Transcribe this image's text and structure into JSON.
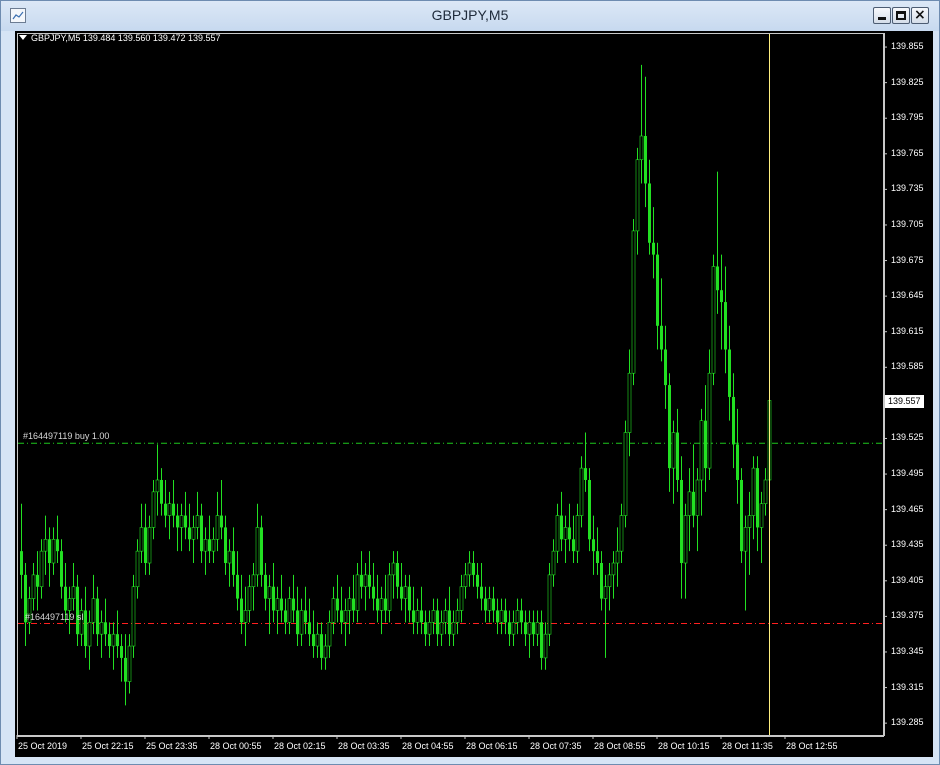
{
  "window": {
    "title": "GBPJPY,M5"
  },
  "colors": {
    "background": "#000000",
    "candle": "#22e022",
    "buy_line": "#1ec81e",
    "sl_line": "#ff2020",
    "cursor_line": "#fff080",
    "axis_text": "#ffffff"
  },
  "icons": [
    "chart-window-icon",
    "minimize-icon",
    "maximize-icon",
    "close-icon",
    "dropdown-triangle-icon"
  ],
  "chart_data": {
    "type": "candlestick",
    "symbol_header": "GBPJPY,M5  139.484 139.560 139.472 139.557",
    "symbol": "GBPJPY",
    "timeframe": "M5",
    "ohlc_header": {
      "open": 139.484,
      "high": 139.56,
      "low": 139.472,
      "close": 139.557
    },
    "current_price": "139.557",
    "ylim": [
      139.28,
      139.87
    ],
    "y_ticks": [
      "139.855",
      "139.825",
      "139.795",
      "139.765",
      "139.735",
      "139.705",
      "139.675",
      "139.645",
      "139.615",
      "139.585",
      "139.555",
      "139.525",
      "139.495",
      "139.465",
      "139.435",
      "139.405",
      "139.375",
      "139.345",
      "139.315",
      "139.285"
    ],
    "x_ticks": [
      "25 Oct 2019",
      "25 Oct 22:15",
      "25 Oct 23:35",
      "28 Oct 00:55",
      "28 Oct 02:15",
      "28 Oct 03:35",
      "28 Oct 04:55",
      "28 Oct 06:15",
      "28 Oct 07:35",
      "28 Oct 08:55",
      "28 Oct 10:15",
      "28 Oct 11:35",
      "28 Oct 12:55"
    ],
    "order_lines": [
      {
        "label": "#164497119 buy 1.00",
        "price": 139.521,
        "kind": "buy"
      },
      {
        "label": "#164497119 sl",
        "price": 139.369,
        "kind": "sl"
      }
    ],
    "cursor_x_bar": 187,
    "bar_spacing_px": 4,
    "bars": [
      [
        139.43,
        139.47,
        139.39,
        139.41
      ],
      [
        139.41,
        139.42,
        139.35,
        139.37
      ],
      [
        139.37,
        139.4,
        139.36,
        139.39
      ],
      [
        139.39,
        139.42,
        139.38,
        139.41
      ],
      [
        139.41,
        139.43,
        139.38,
        139.4
      ],
      [
        139.4,
        139.44,
        139.39,
        139.43
      ],
      [
        139.43,
        139.46,
        139.41,
        139.44
      ],
      [
        139.44,
        139.45,
        139.4,
        139.42
      ],
      [
        139.42,
        139.45,
        139.41,
        139.44
      ],
      [
        139.44,
        139.46,
        139.42,
        139.43
      ],
      [
        139.43,
        139.44,
        139.39,
        139.4
      ],
      [
        139.4,
        139.42,
        139.37,
        139.38
      ],
      [
        139.38,
        139.4,
        139.36,
        139.39
      ],
      [
        139.39,
        139.42,
        139.38,
        139.4
      ],
      [
        139.4,
        139.41,
        139.35,
        139.36
      ],
      [
        139.36,
        139.39,
        139.35,
        139.38
      ],
      [
        139.38,
        139.4,
        139.34,
        139.35
      ],
      [
        139.35,
        139.38,
        139.33,
        139.37
      ],
      [
        139.37,
        139.41,
        139.36,
        139.39
      ],
      [
        139.39,
        139.4,
        139.35,
        139.36
      ],
      [
        139.36,
        139.38,
        139.34,
        139.37
      ],
      [
        139.37,
        139.39,
        139.35,
        139.36
      ],
      [
        139.36,
        139.37,
        139.34,
        139.35
      ],
      [
        139.35,
        139.37,
        139.33,
        139.36
      ],
      [
        139.36,
        139.38,
        139.34,
        139.35
      ],
      [
        139.35,
        139.36,
        139.32,
        139.34
      ],
      [
        139.34,
        139.36,
        139.3,
        139.32
      ],
      [
        139.32,
        139.36,
        139.31,
        139.35
      ],
      [
        139.35,
        139.41,
        139.34,
        139.4
      ],
      [
        139.4,
        139.44,
        139.39,
        139.43
      ],
      [
        139.43,
        139.47,
        139.42,
        139.45
      ],
      [
        139.45,
        139.47,
        139.41,
        139.42
      ],
      [
        139.42,
        139.46,
        139.41,
        139.45
      ],
      [
        139.45,
        139.49,
        139.44,
        139.48
      ],
      [
        139.48,
        139.52,
        139.46,
        139.49
      ],
      [
        139.49,
        139.5,
        139.46,
        139.47
      ],
      [
        139.47,
        139.49,
        139.45,
        139.46
      ],
      [
        139.46,
        139.48,
        139.44,
        139.47
      ],
      [
        139.47,
        139.49,
        139.45,
        139.46
      ],
      [
        139.46,
        139.47,
        139.43,
        139.45
      ],
      [
        139.45,
        139.47,
        139.43,
        139.46
      ],
      [
        139.46,
        139.48,
        139.44,
        139.45
      ],
      [
        139.45,
        139.47,
        139.43,
        139.44
      ],
      [
        139.44,
        139.46,
        139.42,
        139.45
      ],
      [
        139.45,
        139.48,
        139.44,
        139.46
      ],
      [
        139.46,
        139.47,
        139.42,
        139.43
      ],
      [
        139.43,
        139.45,
        139.41,
        139.44
      ],
      [
        139.44,
        139.46,
        139.42,
        139.43
      ],
      [
        139.43,
        139.45,
        139.42,
        139.44
      ],
      [
        139.44,
        139.48,
        139.43,
        139.46
      ],
      [
        139.46,
        139.49,
        139.44,
        139.45
      ],
      [
        139.45,
        139.46,
        139.41,
        139.42
      ],
      [
        139.42,
        139.44,
        139.4,
        139.43
      ],
      [
        139.43,
        139.45,
        139.4,
        139.41
      ],
      [
        139.41,
        139.43,
        139.38,
        139.39
      ],
      [
        139.39,
        139.41,
        139.36,
        139.37
      ],
      [
        139.37,
        139.4,
        139.35,
        139.38
      ],
      [
        139.38,
        139.41,
        139.37,
        139.4
      ],
      [
        139.4,
        139.42,
        139.38,
        139.41
      ],
      [
        139.41,
        139.47,
        139.4,
        139.45
      ],
      [
        139.45,
        139.46,
        139.4,
        139.41
      ],
      [
        139.41,
        139.42,
        139.38,
        139.39
      ],
      [
        139.39,
        139.41,
        139.36,
        139.4
      ],
      [
        139.4,
        139.42,
        139.37,
        139.38
      ],
      [
        139.38,
        139.4,
        139.36,
        139.39
      ],
      [
        139.39,
        139.41,
        139.37,
        139.38
      ],
      [
        139.38,
        139.39,
        139.36,
        139.37
      ],
      [
        139.37,
        139.4,
        139.36,
        139.39
      ],
      [
        139.39,
        139.41,
        139.37,
        139.38
      ],
      [
        139.38,
        139.4,
        139.35,
        139.36
      ],
      [
        139.36,
        139.39,
        139.35,
        139.38
      ],
      [
        139.38,
        139.4,
        139.36,
        139.37
      ],
      [
        139.37,
        139.39,
        139.35,
        139.36
      ],
      [
        139.36,
        139.38,
        139.34,
        139.35
      ],
      [
        139.35,
        139.37,
        139.34,
        139.36
      ],
      [
        139.36,
        139.37,
        139.33,
        139.34
      ],
      [
        139.34,
        139.36,
        139.33,
        139.35
      ],
      [
        139.35,
        139.38,
        139.34,
        139.37
      ],
      [
        139.37,
        139.4,
        139.36,
        139.39
      ],
      [
        139.39,
        139.41,
        139.37,
        139.38
      ],
      [
        139.38,
        139.4,
        139.36,
        139.37
      ],
      [
        139.37,
        139.39,
        139.35,
        139.38
      ],
      [
        139.38,
        139.4,
        139.36,
        139.39
      ],
      [
        139.39,
        139.41,
        139.37,
        139.38
      ],
      [
        139.38,
        139.42,
        139.37,
        139.41
      ],
      [
        139.41,
        139.43,
        139.39,
        139.4
      ],
      [
        139.4,
        139.42,
        139.38,
        139.41
      ],
      [
        139.41,
        139.43,
        139.39,
        139.4
      ],
      [
        139.4,
        139.42,
        139.38,
        139.39
      ],
      [
        139.39,
        139.41,
        139.37,
        139.38
      ],
      [
        139.38,
        139.4,
        139.36,
        139.39
      ],
      [
        139.39,
        139.41,
        139.37,
        139.38
      ],
      [
        139.38,
        139.42,
        139.37,
        139.41
      ],
      [
        139.41,
        139.43,
        139.39,
        139.42
      ],
      [
        139.42,
        139.43,
        139.39,
        139.4
      ],
      [
        139.4,
        139.42,
        139.38,
        139.39
      ],
      [
        139.39,
        139.41,
        139.37,
        139.4
      ],
      [
        139.4,
        139.41,
        139.37,
        139.38
      ],
      [
        139.38,
        139.4,
        139.36,
        139.37
      ],
      [
        139.37,
        139.39,
        139.36,
        139.38
      ],
      [
        139.38,
        139.4,
        139.36,
        139.37
      ],
      [
        139.37,
        139.38,
        139.35,
        139.36
      ],
      [
        139.36,
        139.38,
        139.35,
        139.37
      ],
      [
        139.37,
        139.39,
        139.36,
        139.38
      ],
      [
        139.38,
        139.39,
        139.35,
        139.36
      ],
      [
        139.36,
        139.38,
        139.35,
        139.37
      ],
      [
        139.37,
        139.39,
        139.36,
        139.38
      ],
      [
        139.38,
        139.4,
        139.35,
        139.36
      ],
      [
        139.36,
        139.38,
        139.35,
        139.37
      ],
      [
        139.37,
        139.39,
        139.36,
        139.38
      ],
      [
        139.38,
        139.41,
        139.37,
        139.4
      ],
      [
        139.4,
        139.42,
        139.39,
        139.41
      ],
      [
        139.41,
        139.43,
        139.4,
        139.42
      ],
      [
        139.42,
        139.43,
        139.4,
        139.41
      ],
      [
        139.41,
        139.42,
        139.39,
        139.4
      ],
      [
        139.4,
        139.42,
        139.38,
        139.39
      ],
      [
        139.39,
        139.4,
        139.37,
        139.38
      ],
      [
        139.38,
        139.4,
        139.37,
        139.39
      ],
      [
        139.39,
        139.4,
        139.37,
        139.38
      ],
      [
        139.38,
        139.39,
        139.36,
        139.37
      ],
      [
        139.37,
        139.39,
        139.36,
        139.38
      ],
      [
        139.38,
        139.39,
        139.36,
        139.37
      ],
      [
        139.37,
        139.38,
        139.35,
        139.36
      ],
      [
        139.36,
        139.38,
        139.35,
        139.37
      ],
      [
        139.37,
        139.39,
        139.36,
        139.38
      ],
      [
        139.38,
        139.39,
        139.36,
        139.37
      ],
      [
        139.37,
        139.38,
        139.35,
        139.36
      ],
      [
        139.36,
        139.38,
        139.34,
        139.37
      ],
      [
        139.37,
        139.38,
        139.35,
        139.36
      ],
      [
        139.36,
        139.38,
        139.35,
        139.37
      ],
      [
        139.37,
        139.38,
        139.33,
        139.34
      ],
      [
        139.34,
        139.37,
        139.33,
        139.36
      ],
      [
        139.36,
        139.42,
        139.35,
        139.41
      ],
      [
        139.41,
        139.44,
        139.4,
        139.43
      ],
      [
        139.43,
        139.47,
        139.42,
        139.46
      ],
      [
        139.46,
        139.48,
        139.43,
        139.44
      ],
      [
        139.44,
        139.46,
        139.42,
        139.45
      ],
      [
        139.45,
        139.47,
        139.43,
        139.44
      ],
      [
        139.44,
        139.46,
        139.42,
        139.43
      ],
      [
        139.43,
        139.47,
        139.42,
        139.46
      ],
      [
        139.46,
        139.51,
        139.45,
        139.5
      ],
      [
        139.5,
        139.53,
        139.48,
        139.49
      ],
      [
        139.49,
        139.5,
        139.43,
        139.44
      ],
      [
        139.44,
        139.46,
        139.41,
        139.43
      ],
      [
        139.43,
        139.45,
        139.41,
        139.42
      ],
      [
        139.42,
        139.43,
        139.38,
        139.39
      ],
      [
        139.39,
        139.41,
        139.34,
        139.4
      ],
      [
        139.4,
        139.42,
        139.38,
        139.41
      ],
      [
        139.41,
        139.43,
        139.39,
        139.42
      ],
      [
        139.42,
        139.45,
        139.4,
        139.43
      ],
      [
        139.43,
        139.47,
        139.42,
        139.46
      ],
      [
        139.46,
        139.54,
        139.45,
        139.53
      ],
      [
        139.53,
        139.6,
        139.51,
        139.58
      ],
      [
        139.58,
        139.71,
        139.57,
        139.7
      ],
      [
        139.7,
        139.77,
        139.68,
        139.76
      ],
      [
        139.76,
        139.84,
        139.74,
        139.78
      ],
      [
        139.78,
        139.83,
        139.72,
        139.74
      ],
      [
        139.74,
        139.76,
        139.68,
        139.69
      ],
      [
        139.69,
        139.72,
        139.66,
        139.68
      ],
      [
        139.68,
        139.69,
        139.6,
        139.62
      ],
      [
        139.62,
        139.66,
        139.59,
        139.6
      ],
      [
        139.6,
        139.62,
        139.55,
        139.57
      ],
      [
        139.57,
        139.58,
        139.48,
        139.5
      ],
      [
        139.5,
        139.54,
        139.47,
        139.53
      ],
      [
        139.53,
        139.55,
        139.48,
        139.49
      ],
      [
        139.49,
        139.51,
        139.39,
        139.42
      ],
      [
        139.42,
        139.47,
        139.39,
        139.46
      ],
      [
        139.46,
        139.5,
        139.43,
        139.48
      ],
      [
        139.48,
        139.52,
        139.45,
        139.46
      ],
      [
        139.46,
        139.5,
        139.43,
        139.49
      ],
      [
        139.49,
        139.55,
        139.46,
        139.54
      ],
      [
        139.54,
        139.57,
        139.48,
        139.5
      ],
      [
        139.5,
        139.6,
        139.49,
        139.58
      ],
      [
        139.58,
        139.68,
        139.57,
        139.67
      ],
      [
        139.67,
        139.75,
        139.63,
        139.65
      ],
      [
        139.65,
        139.68,
        139.6,
        139.64
      ],
      [
        139.64,
        139.67,
        139.58,
        139.6
      ],
      [
        139.6,
        139.62,
        139.54,
        139.56
      ],
      [
        139.56,
        139.58,
        139.5,
        139.52
      ],
      [
        139.52,
        139.55,
        139.47,
        139.49
      ],
      [
        139.49,
        139.5,
        139.42,
        139.43
      ],
      [
        139.43,
        139.46,
        139.38,
        139.45
      ],
      [
        139.45,
        139.48,
        139.41,
        139.46
      ],
      [
        139.46,
        139.51,
        139.44,
        139.5
      ],
      [
        139.5,
        139.51,
        139.43,
        139.45
      ],
      [
        139.45,
        139.48,
        139.42,
        139.47
      ],
      [
        139.47,
        139.5,
        139.46,
        139.49
      ],
      [
        139.49,
        139.56,
        139.48,
        139.557
      ]
    ]
  }
}
